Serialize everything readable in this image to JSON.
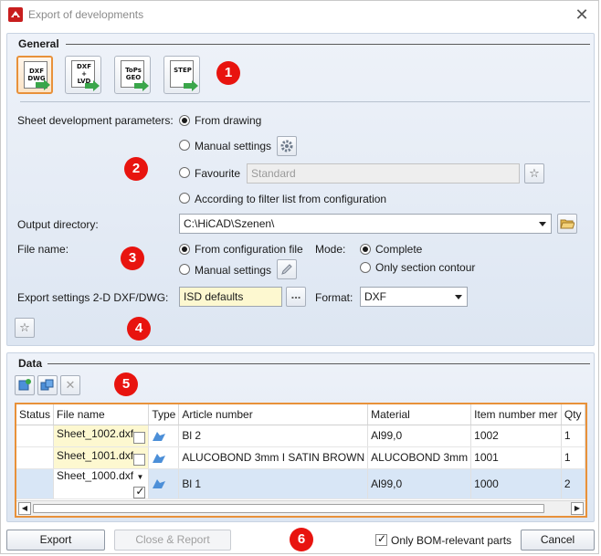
{
  "window": {
    "title": "Export of developments",
    "close_icon": "close-icon"
  },
  "general": {
    "group_title": "General",
    "formats": [
      {
        "label_line1": "DXF",
        "label_line2": "DWG",
        "label_line3": "",
        "active": true
      },
      {
        "label_line1": "DXF",
        "label_line2": "+",
        "label_line3": "LVD",
        "active": false
      },
      {
        "label_line1": "ToPs",
        "label_line2": "GEO",
        "label_line3": "",
        "active": false
      },
      {
        "label_line1": "STEP",
        "label_line2": "",
        "label_line3": "",
        "active": false
      }
    ],
    "sheet_params_label": "Sheet development parameters:",
    "opt_from_drawing": "From drawing",
    "opt_manual_settings": "Manual settings",
    "opt_favourite": "Favourite",
    "favourite_value": "Standard",
    "opt_filter_list": "According to filter list from configuration",
    "output_dir_label": "Output directory:",
    "output_dir_value": "C:\\HiCAD\\Szenen\\",
    "file_name_label": "File name:",
    "opt_from_config_file": "From configuration file",
    "opt_manual_settings_2": "Manual settings",
    "mode_label": "Mode:",
    "opt_complete": "Complete",
    "opt_only_section": "Only section contour",
    "export_settings_label": "Export settings 2-D DXF/DWG:",
    "export_settings_value": "ISD defaults",
    "browse_label": "...",
    "format_label": "Format:",
    "format_value": "DXF"
  },
  "data": {
    "group_title": "Data",
    "columns": [
      "Status",
      "File name",
      "Type",
      "Article number",
      "Material",
      "Item number mer",
      "Qty"
    ],
    "rows": [
      {
        "status": "",
        "file_name": "Sheet_1002.dxf",
        "checked": false,
        "article": "Bl 2",
        "material": "Al99,0",
        "item": "1002",
        "qty": "1",
        "selected": false
      },
      {
        "status": "",
        "file_name": "Sheet_1001.dxf",
        "checked": false,
        "article": "ALUCOBOND 3mm I SATIN BROWN",
        "material": "ALUCOBOND 3mm",
        "item": "1001",
        "qty": "1",
        "selected": false
      },
      {
        "status": "",
        "file_name": "Sheet_1000.dxf",
        "checked": true,
        "article": "Bl 1",
        "material": "Al99,0",
        "item": "1000",
        "qty": "2",
        "selected": true
      }
    ]
  },
  "badges": [
    "1",
    "2",
    "3",
    "4",
    "5",
    "6"
  ],
  "footer": {
    "export_label": "Export",
    "close_report_label": "Close & Report",
    "bom_label": "Only BOM-relevant parts",
    "bom_checked": true,
    "cancel_label": "Cancel"
  },
  "colors": {
    "accent_orange": "#e8913a",
    "badge_red": "#e8140f",
    "panel_blue": "#dde6f2"
  }
}
